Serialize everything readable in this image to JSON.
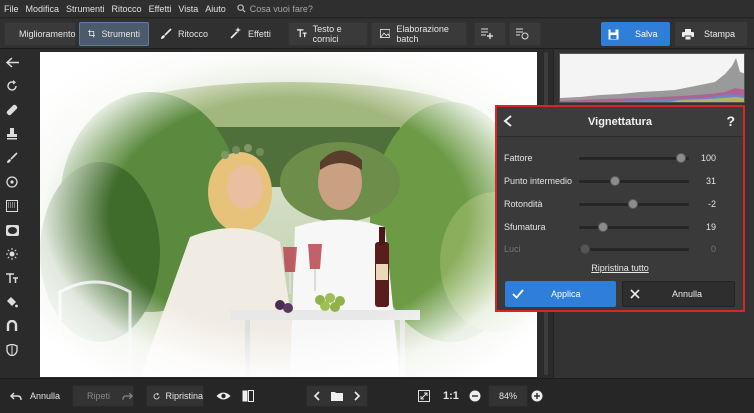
{
  "menu": {
    "items": [
      "File",
      "Modifica",
      "Strumenti",
      "Ritocco",
      "Effetti",
      "Vista",
      "Aiuto"
    ],
    "search_placeholder": "Cosa vuoi fare?"
  },
  "toolbar": {
    "tabs": [
      {
        "label": "Miglioramento",
        "icon": "sliders-icon",
        "active": false
      },
      {
        "label": "Strumenti",
        "icon": "crop-icon",
        "active": true
      },
      {
        "label": "Ritocco",
        "icon": "brush-icon",
        "active": false
      },
      {
        "label": "Effetti",
        "icon": "magic-wand-icon",
        "active": false
      },
      {
        "label": "Testo e cornici",
        "icon": "text-icon",
        "active": false
      },
      {
        "label": "Elaborazione batch",
        "icon": "images-icon",
        "active": false
      }
    ],
    "save_label": "Salva",
    "print_label": "Stampa",
    "accent_color": "#2f7fd8"
  },
  "left_tools": [
    "back-arrow-icon",
    "rotate-icon",
    "heal-icon",
    "stamp-icon",
    "brush-icon",
    "radial-icon",
    "gradient-icon",
    "vignette-icon",
    "light-icon",
    "text-icon",
    "fill-icon",
    "magnet-icon",
    "shape-icon"
  ],
  "vignette": {
    "title": "Vignettatura",
    "help": "?",
    "sliders": [
      {
        "label": "Fattore",
        "value": "100",
        "fraction": 0.93,
        "enabled": true
      },
      {
        "label": "Punto intermedio",
        "value": "31",
        "fraction": 0.33,
        "enabled": true
      },
      {
        "label": "Rotondità",
        "value": "-2",
        "fraction": 0.49,
        "enabled": true
      },
      {
        "label": "Sfumatura",
        "value": "19",
        "fraction": 0.22,
        "enabled": true
      },
      {
        "label": "Luci",
        "value": "0",
        "fraction": 0.05,
        "enabled": false
      }
    ],
    "reset_label": "Ripristina tutto",
    "apply_label": "Applica",
    "cancel_label": "Annulla",
    "highlight_color": "#d82525"
  },
  "bottom": {
    "undo_label": "Annulla",
    "redo_label": "Ripeti",
    "restore_label": "Ripristina",
    "ratio_label": "1:1",
    "zoom_value": "84%"
  }
}
